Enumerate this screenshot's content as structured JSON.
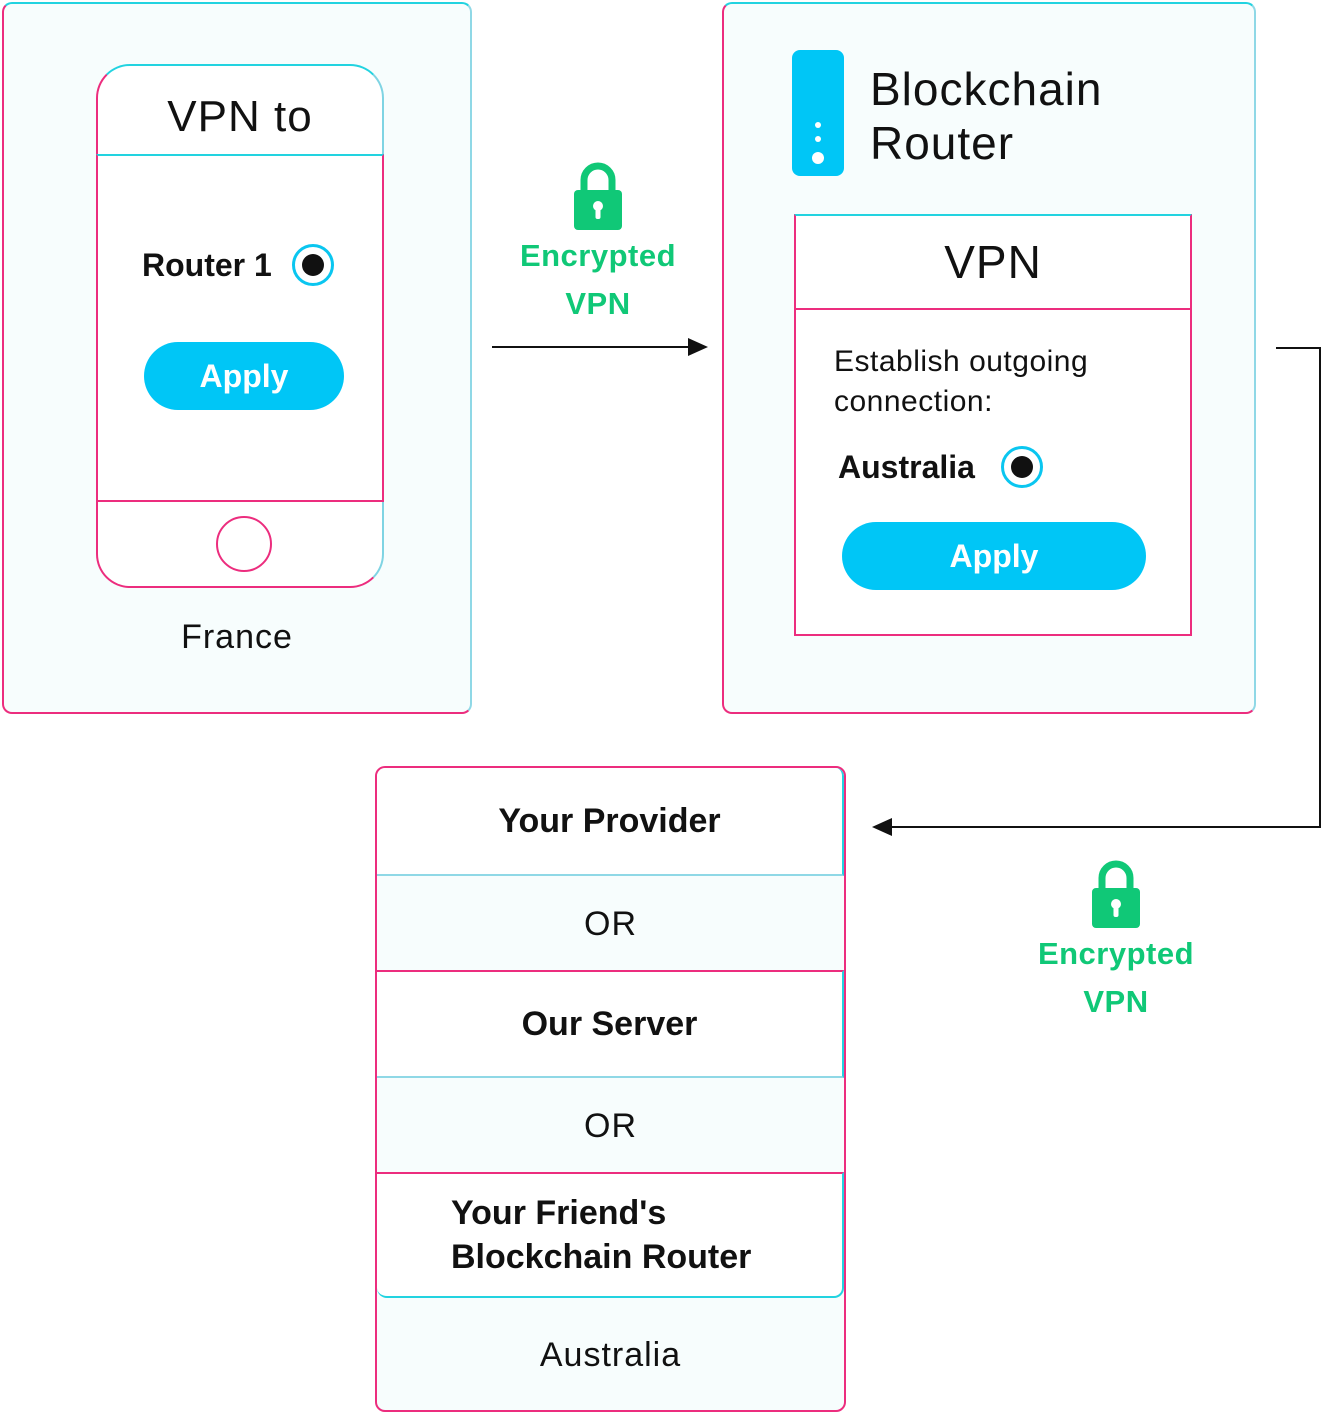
{
  "source": {
    "phone_title": "VPN to",
    "option_label": "Router 1",
    "apply_label": "Apply",
    "location": "France"
  },
  "link_top": {
    "label_line1": "Encrypted",
    "label_line2": "VPN"
  },
  "router": {
    "title": "Blockchain\nRouter",
    "panel_header": "VPN",
    "description": "Establish outgoing connection:",
    "option_label": "Australia",
    "apply_label": "Apply"
  },
  "link_bottom": {
    "label_line1": "Encrypted",
    "label_line2": "VPN"
  },
  "destination": {
    "option_1": "Your Provider",
    "separator_1": "OR",
    "option_2": "Our Server",
    "separator_2": "OR",
    "option_3": "Your Friend's\nBlockchain Router",
    "location": "Australia"
  },
  "colors": {
    "accent_blue": "#00c6f6",
    "encrypted_green": "#10c877",
    "border_pink": "#ec2d7e",
    "border_cyan": "#22d3e0"
  },
  "icons": [
    "lock-icon",
    "radio-selected-icon",
    "router-device-icon",
    "arrow-right-icon",
    "arrow-left-icon"
  ]
}
